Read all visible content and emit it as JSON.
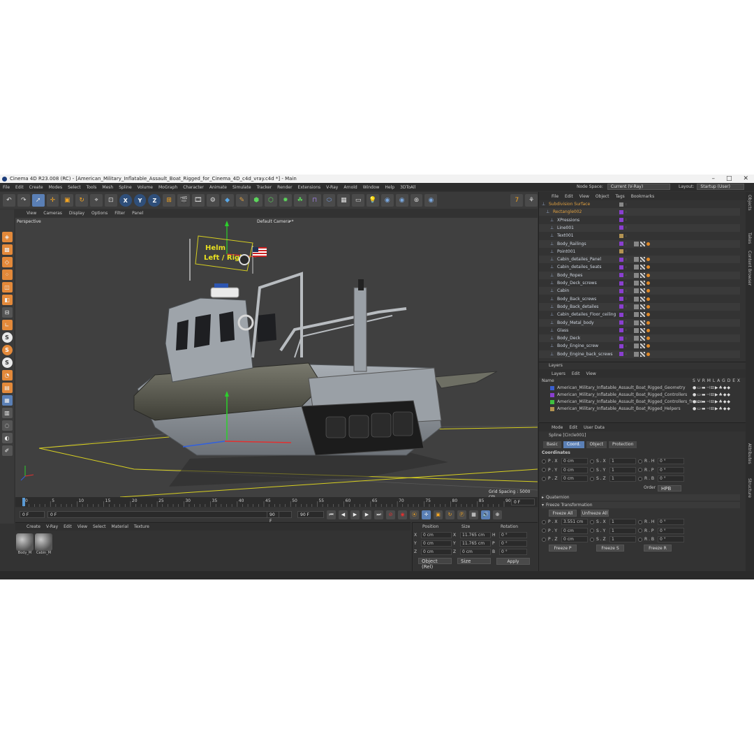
{
  "window": {
    "title": "Cinema 4D R23.008 (RC) - [American_Military_Inflatable_Assault_Boat_Rigged_for_Cinema_4D_c4d_vray.c4d *] - Main",
    "minimize": "–",
    "maximize": "□",
    "close": "✕"
  },
  "menu": [
    "File",
    "Edit",
    "Create",
    "Modes",
    "Select",
    "Tools",
    "Mesh",
    "Spline",
    "Volume",
    "MoGraph",
    "Character",
    "Animate",
    "Simulate",
    "Tracker",
    "Render",
    "Extensions",
    "V-Ray",
    "Arnold",
    "Window",
    "Help",
    "3DToAll"
  ],
  "nodespace": {
    "label": "Node Space:",
    "value": "Current (V-Ray)"
  },
  "layout": {
    "label": "Layout:",
    "value": "Startup (User)"
  },
  "toolbar": {
    "x": "X",
    "y": "Y",
    "z": "Z"
  },
  "viewport": {
    "menu": [
      "View",
      "Cameras",
      "Display",
      "Options",
      "Filter",
      "Panel"
    ],
    "perspective": "Perspective",
    "camera": "Default Camera",
    "camera_icon": "•*",
    "grid_spacing": "Grid Spacing : 5000 cm",
    "sign_line1": "Helm",
    "sign_line2": "Left / Right"
  },
  "timeline": {
    "ticks": [
      "0",
      "5",
      "10",
      "15",
      "20",
      "25",
      "30",
      "35",
      "40",
      "45",
      "50",
      "55",
      "60",
      "65",
      "70",
      "75",
      "80",
      "85",
      "90"
    ],
    "current": "0 F"
  },
  "playbar": {
    "start": "0 F",
    "start2": "0 F",
    "end": "90 F",
    "end2": "90 F"
  },
  "materials": {
    "menu": [
      "Create",
      "V-Ray",
      "Edit",
      "View",
      "Select",
      "Material",
      "Texture"
    ],
    "items": [
      "Body_M",
      "Cabin_M"
    ]
  },
  "coords": {
    "headers": [
      "Position",
      "Size",
      "Rotation"
    ],
    "rows": [
      {
        "axis": "X",
        "pos": "0 cm",
        "saxis": "X",
        "size": "11.765 cm",
        "raxis": "H",
        "rot": "0 °"
      },
      {
        "axis": "Y",
        "pos": "0 cm",
        "saxis": "Y",
        "size": "11.765 cm",
        "raxis": "P",
        "rot": "0 °"
      },
      {
        "axis": "Z",
        "pos": "0 cm",
        "saxis": "Z",
        "size": "0 cm",
        "raxis": "B",
        "rot": "0 °"
      }
    ],
    "mode": "Object (Rel)",
    "sizemode": "Size",
    "apply": "Apply"
  },
  "objects": {
    "menu": [
      "File",
      "Edit",
      "View",
      "Object",
      "Tags",
      "Bookmarks"
    ],
    "rows": [
      {
        "name": "Subdivision Surface",
        "color": "#e0a040",
        "swatch": "#888888"
      },
      {
        "name": "Rectangle002",
        "color": "#e0a040",
        "swatch": "#8a3fd0"
      },
      {
        "name": "XPressions",
        "color": "#cfd6e0",
        "swatch": "#8a3fd0"
      },
      {
        "name": "Line001",
        "color": "#cfd6e0",
        "swatch": "#8a3fd0"
      },
      {
        "name": "Text001",
        "color": "#cfd6e0",
        "swatch": "#b39352"
      },
      {
        "name": "Body_Railings",
        "color": "#cfd6e0",
        "swatch": "#8a3fd0"
      },
      {
        "name": "Point001",
        "color": "#cfd6e0",
        "swatch": "#b39352"
      },
      {
        "name": "Cabin_detailes_Panel",
        "color": "#cfd6e0",
        "swatch": "#8a3fd0"
      },
      {
        "name": "Cabin_detailes_Seats",
        "color": "#cfd6e0",
        "swatch": "#8a3fd0"
      },
      {
        "name": "Body_Ropes",
        "color": "#cfd6e0",
        "swatch": "#8a3fd0"
      },
      {
        "name": "Body_Deck_screws",
        "color": "#cfd6e0",
        "swatch": "#8a3fd0"
      },
      {
        "name": "Cabin",
        "color": "#cfd6e0",
        "swatch": "#8a3fd0"
      },
      {
        "name": "Body_Back_screws",
        "color": "#cfd6e0",
        "swatch": "#8a3fd0"
      },
      {
        "name": "Body_Back_detailes",
        "color": "#cfd6e0",
        "swatch": "#8a3fd0"
      },
      {
        "name": "Cabin_detailes_Floor_ceiling",
        "color": "#cfd6e0",
        "swatch": "#8a3fd0"
      },
      {
        "name": "Body_Metal_body",
        "color": "#cfd6e0",
        "swatch": "#8a3fd0"
      },
      {
        "name": "Glass",
        "color": "#cfd6e0",
        "swatch": "#8a3fd0"
      },
      {
        "name": "Body_Deck",
        "color": "#cfd6e0",
        "swatch": "#8a3fd0"
      },
      {
        "name": "Body_Engine_screw",
        "color": "#cfd6e0",
        "swatch": "#8a3fd0"
      },
      {
        "name": "Body_Engine_back_screws",
        "color": "#cfd6e0",
        "swatch": "#8a3fd0"
      }
    ]
  },
  "layers": {
    "title": "Layers",
    "menu": [
      "Layers",
      "Edit",
      "View"
    ],
    "name_header": "Name",
    "cols": "S V R M L A G D E X",
    "rows": [
      {
        "name": "American_Military_Inflatable_Assault_Boat_Rigged_Geometry",
        "color": "#3a5fd0"
      },
      {
        "name": "American_Military_Inflatable_Assault_Boat_Rigged_Controllers",
        "color": "#8a3fd0"
      },
      {
        "name": "American_Military_Inflatable_Assault_Boat_Rigged_Controllers_freeze",
        "color": "#3fc03f"
      },
      {
        "name": "American_Military_Inflatable_Assault_Boat_Rigged_Helpers",
        "color": "#b39352"
      }
    ]
  },
  "attributes": {
    "menu": [
      "Mode",
      "Edit",
      "User Data"
    ],
    "object": "Spline [Circle001]",
    "tabs": [
      "Basic",
      "Coord.",
      "Object",
      "Protection"
    ],
    "section": "Coordinates",
    "rows": [
      {
        "a": "P . X",
        "av": "0 cm",
        "b": "S . X",
        "bv": "1",
        "c": "R . H",
        "cv": "0 °"
      },
      {
        "a": "P . Y",
        "av": "0 cm",
        "b": "S . Y",
        "bv": "1",
        "c": "R . P",
        "cv": "0 °"
      },
      {
        "a": "P . Z",
        "av": "0 cm",
        "b": "S . Z",
        "bv": "1",
        "c": "R . B",
        "cv": "0 °"
      }
    ],
    "order_label": "Order",
    "order_value": "HPB",
    "quaternion": "Quaternion",
    "freeze": "Freeze Transformation",
    "freeze_all": "Freeze All",
    "unfreeze_all": "Unfreeze All",
    "frows": [
      {
        "a": "P . X",
        "av": "3.551 cm",
        "b": "S . X",
        "bv": "1",
        "c": "R . H",
        "cv": "0 °"
      },
      {
        "a": "P . Y",
        "av": "0 cm",
        "b": "S . Y",
        "bv": "1",
        "c": "R . P",
        "cv": "0 °"
      },
      {
        "a": "P . Z",
        "av": "0 cm",
        "b": "S . Z",
        "bv": "1",
        "c": "R . B",
        "cv": "0 °"
      }
    ],
    "freeze_p": "Freeze P",
    "freeze_s": "Freeze S",
    "freeze_r": "Freeze R"
  },
  "sidetabs": [
    "Objects",
    "Takes",
    "Content Browser",
    "Attributes",
    "Structure"
  ]
}
